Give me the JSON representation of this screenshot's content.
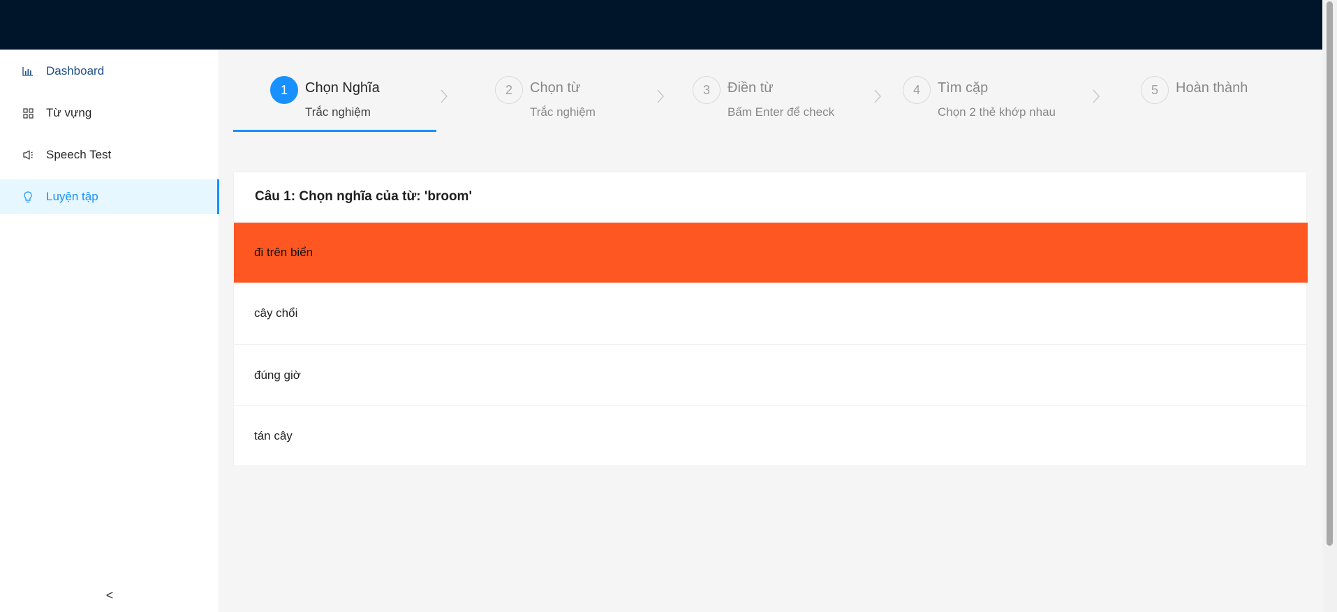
{
  "sidebar": {
    "items": [
      {
        "label": "Dashboard",
        "icon": "bar-chart-icon"
      },
      {
        "label": "Từ vựng",
        "icon": "grid-icon"
      },
      {
        "label": "Speech Test",
        "icon": "sound-icon"
      },
      {
        "label": "Luyện tập",
        "icon": "bulb-icon"
      }
    ],
    "active_index": 3,
    "collapse_label": "<"
  },
  "steps": [
    {
      "number": "1",
      "title": "Chọn Nghĩa",
      "desc": "Trắc nghiệm",
      "state": "current"
    },
    {
      "number": "2",
      "title": "Chọn từ",
      "desc": "Trắc nghiệm",
      "state": "wait"
    },
    {
      "number": "3",
      "title": "Điền từ",
      "desc": "Bấm Enter để check",
      "state": "wait"
    },
    {
      "number": "4",
      "title": "Tìm cặp",
      "desc": "Chọn 2 thẻ khớp nhau",
      "state": "wait"
    },
    {
      "number": "5",
      "title": "Hoàn thành",
      "desc": "",
      "state": "wait"
    }
  ],
  "quiz": {
    "question": "Câu 1: Chọn nghĩa của từ: 'broom'",
    "options": [
      "đi trên biển",
      "cây chổi",
      "đúng giờ",
      "tán cây"
    ],
    "selected_index": 0
  },
  "colors": {
    "topbar": "#001529",
    "accent": "#1890ff",
    "selected_option": "#ff5722",
    "active_menu_bg": "#e6f7ff"
  }
}
